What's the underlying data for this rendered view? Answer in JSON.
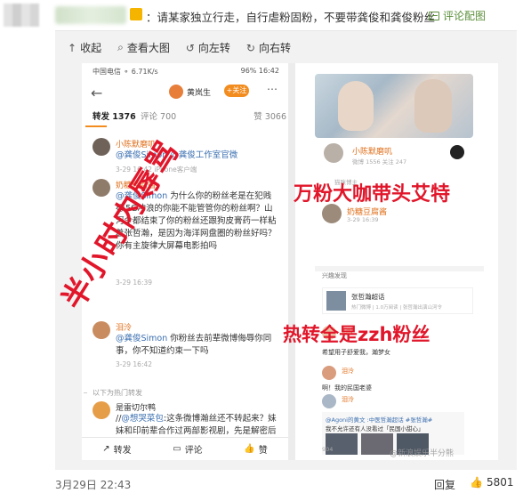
{
  "post": {
    "text": "：请某家独立行走，自行虐粉固粉，不要带龚俊和龚俊粉丝",
    "comment_pic_label": "评论配图"
  },
  "viewer": {
    "toolbar": {
      "collapse": "收起",
      "view_large": "查看大图",
      "rotate_left": "向左转",
      "rotate_right": "向右转"
    }
  },
  "screenshot": {
    "left": {
      "status_left": "中国电信 ⚬ 6.71K/s",
      "status_right": "96% 16:42",
      "nav_name": "黄岚生",
      "nav_follow": "+关注",
      "tabs": {
        "forward": "转发 1376",
        "comment": "评论 700",
        "like": "赞 3066"
      },
      "comments": [
        {
          "name": "小陈默磨叽",
          "at": "@龚俊Simon",
          "text_suffix": " @龚俊工作室官微",
          "time": "3-29 16:42   iPhone客户端"
        },
        {
          "name": "奶糖豆腐酱",
          "at": "@龚俊Simon",
          "text_suffix": " 为什么你的粉丝老是在犯贱😭5G冲浪的你能不能管管你的粉丝啊？山河令都结束了你的粉丝还跟狗皮膏药一样粘着张哲瀚，是因为海洋网盘圈的粉丝好吗？你有主旋律大屏幕电影拍吗",
          "time": "3-29 16:39"
        },
        {
          "name": "泪泠",
          "at": "@龚俊Simon",
          "text_suffix": " 你粉丝去前辈微博侮辱你同事，你不知道约束一下吗",
          "time": "3-29 16:42"
        }
      ],
      "hot_label": "以下为热门转发",
      "hot_name": "是雷切尔鸭",
      "hot_text_prefix": "//",
      "hot_at": "@想哭菜包",
      "hot_text": ":这条微博瀚丝还不转起来？妹妹和印前辈合作过两部影视剧，先是解密后是烈火英雄，不说那条微博发得是否合时宜，但前辈艾特",
      "bottom": {
        "forward": "转发",
        "comment": "评论",
        "like": "赞"
      }
    },
    "right": {
      "profile_name": "小陈默磨叽",
      "profile_sub": "微博 1556   关注 247",
      "profile_sub2": "猫咪博主",
      "cmt2_name": "奶糖豆腐酱",
      "cmt2_sub": "3-29 16:39",
      "topic_header": "兴趣发现",
      "topic_title": "张哲瀚超话",
      "topic_sub": "热门微博 | 1.0万阅读 | 张哲瀚出演山河令",
      "c3_name": "泪泠",
      "c3_text": "希望用子舒爱我，瀚梦女",
      "c4_name": "泪泠",
      "c4_text": "啊！我的民国老婆",
      "c5_name": "泪泠",
      "quote_at": "@Agoni的黄文 :中医哲瀚超话 #张哲瀚#",
      "quote_text": "我不允许还有人没看过「民国小甜心」",
      "count": "904"
    },
    "overlays": {
      "ov1": "万粉大咖带头艾特",
      "ov2": "热转全是zzh粉丝",
      "ov3": "半小时内辱骂"
    },
    "watermark": "@新浪娱乐半分熊"
  },
  "footer": {
    "date": "3月29日 22:43",
    "reply": "回复",
    "likes": "5801"
  },
  "colors": {
    "accent_orange": "#f28c1f",
    "overlay_red": "#e1162a",
    "link_blue": "#3b6fb0",
    "green_link": "#5b8f3a"
  }
}
